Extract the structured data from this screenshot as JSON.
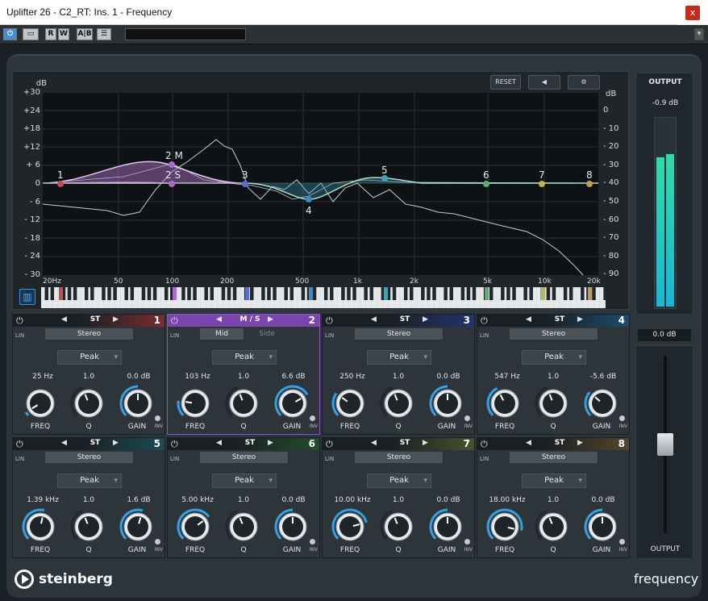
{
  "window": {
    "title": "Uplifter 26 - C2_RT: Ins. 1 - Frequency",
    "close": "x"
  },
  "toolbar": {
    "buttons": [
      "",
      "",
      "R",
      "W",
      "A|B",
      ""
    ]
  },
  "display": {
    "reset": "RESET",
    "db_title_left": "dB",
    "db_title_right": "dB",
    "db_left": [
      "+30",
      "+24",
      "+18",
      "+12",
      "+ 6",
      "0",
      "- 6",
      "- 12",
      "- 18",
      "- 24",
      "- 30"
    ],
    "db_right": [
      "0",
      "- 10",
      "- 20",
      "- 30",
      "- 40",
      "- 50",
      "- 60",
      "- 70",
      "- 80",
      "- 90"
    ],
    "hz": [
      "20Hz",
      "50",
      "100",
      "200",
      "500",
      "1k",
      "2k",
      "5k",
      "10k",
      "20k"
    ],
    "nodes": [
      "1",
      "2 M",
      "2 S",
      "3",
      "4",
      "5",
      "6",
      "7",
      "8"
    ]
  },
  "bands": [
    {
      "num": "1",
      "mode": "ST",
      "channel": "Stereo",
      "type": "Peak",
      "freq": "25 Hz",
      "q": "1.0",
      "gain": "0.0 dB",
      "color": "#7a2c30"
    },
    {
      "num": "2",
      "mode": "M / S",
      "channel_mid": "Mid",
      "channel_side": "Side",
      "type": "Peak",
      "freq": "103 Hz",
      "q": "1.0",
      "gain": "6.6 dB",
      "color": "#6c3a94"
    },
    {
      "num": "3",
      "mode": "ST",
      "channel": "Stereo",
      "type": "Peak",
      "freq": "250 Hz",
      "q": "1.0",
      "gain": "0.0 dB",
      "color": "#23346e"
    },
    {
      "num": "4",
      "mode": "ST",
      "channel": "Stereo",
      "type": "Peak",
      "freq": "547 Hz",
      "q": "1.0",
      "gain": "-5.6 dB",
      "color": "#1d4a6b"
    },
    {
      "num": "5",
      "mode": "ST",
      "channel": "Stereo",
      "type": "Peak",
      "freq": "1.39 kHz",
      "q": "1.0",
      "gain": "1.6 dB",
      "color": "#1c4c55"
    },
    {
      "num": "6",
      "mode": "ST",
      "channel": "Stereo",
      "type": "Peak",
      "freq": "5.00 kHz",
      "q": "1.0",
      "gain": "0.0 dB",
      "color": "#234d2c"
    },
    {
      "num": "7",
      "mode": "ST",
      "channel": "Stereo",
      "type": "Peak",
      "freq": "10.00 kHz",
      "q": "1.0",
      "gain": "0.0 dB",
      "color": "#49512a"
    },
    {
      "num": "8",
      "mode": "ST",
      "channel": "Stereo",
      "type": "Peak",
      "freq": "18.00 kHz",
      "q": "1.0",
      "gain": "0.0 dB",
      "color": "#54462a"
    }
  ],
  "labels": {
    "freq": "FREQ",
    "q": "Q",
    "gain": "GAIN",
    "inv": "INV",
    "lin": "LIN"
  },
  "output": {
    "title": "OUTPUT",
    "peak": "-0.9 dB",
    "gain": "0.0 dB",
    "fader_label": "OUTPUT"
  },
  "brand": {
    "name": "steinberg",
    "product": "frequency"
  }
}
